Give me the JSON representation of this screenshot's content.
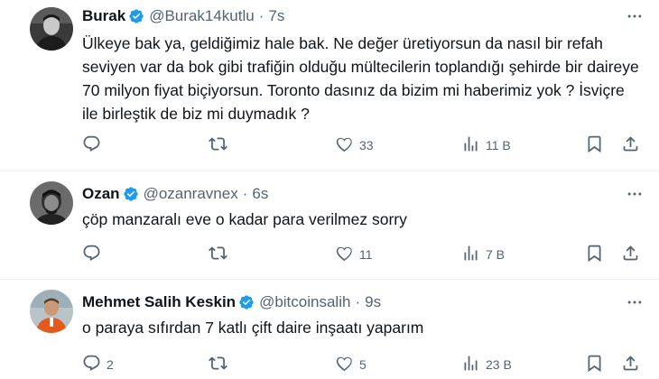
{
  "tweets": [
    {
      "name": "Burak",
      "handle": "@Burak14kutlu",
      "time": "7s",
      "text": "Ülkeye bak ya, geldiğimiz hale bak. Ne değer üretiyorsun da nasıl bir refah seviyen var da bok gibi trafiğin olduğu mültecilerin toplandığı şehirde bir daireye 70 milyon fiyat biçiyorsun. Toronto dasınız da bizim mi haberimiz yok ? İsviçre ile birleştik de biz mi duymadık ?",
      "replies": "",
      "retweets": "",
      "likes": "33",
      "views": "11 B"
    },
    {
      "name": "Ozan",
      "handle": "@ozanravnex",
      "time": "6s",
      "text": "çöp manzaralı eve o kadar para verilmez sorry",
      "replies": "",
      "retweets": "",
      "likes": "11",
      "views": "7 B"
    },
    {
      "name": "Mehmet Salih Keskin",
      "handle": "@bitcoinsalih",
      "time": "9s",
      "text": "o paraya sıfırdan 7 katlı çift daire inşaatı yaparım",
      "replies": "2",
      "retweets": "",
      "likes": "5",
      "views": "23 B"
    }
  ],
  "colors": {
    "verified": "#1d9bf0",
    "muted": "#536471",
    "text": "#0f1419",
    "divider": "#eff3f4"
  },
  "icons": [
    "reply-icon",
    "retweet-icon",
    "like-icon",
    "views-icon",
    "bookmark-icon",
    "share-icon",
    "more-icon",
    "verified-badge-icon"
  ]
}
